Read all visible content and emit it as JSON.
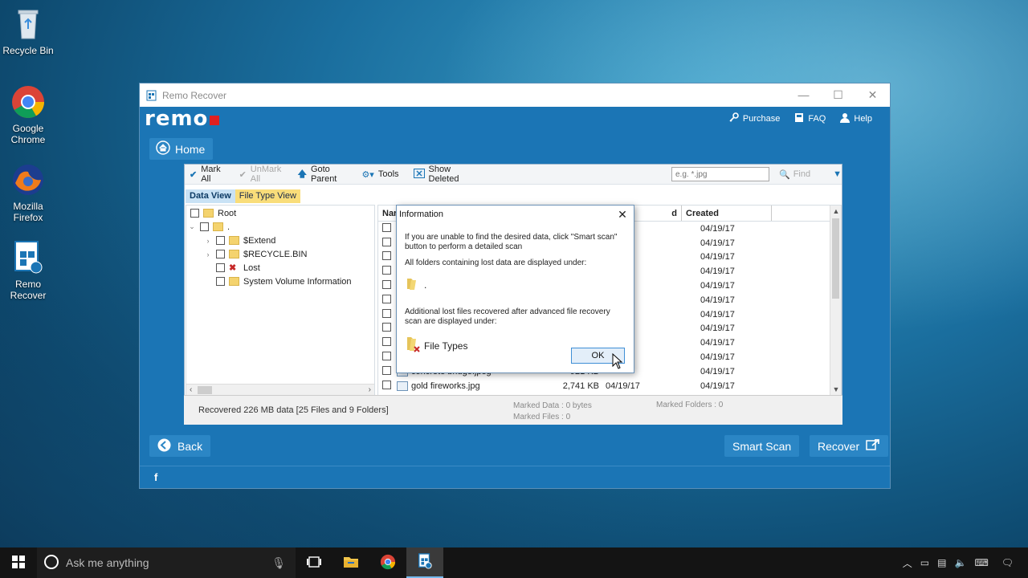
{
  "desktop": {
    "icons": [
      {
        "label": "Recycle Bin"
      },
      {
        "label": "Google Chrome"
      },
      {
        "label": "Mozilla Firefox"
      },
      {
        "label": "Remo Recover"
      }
    ]
  },
  "window": {
    "title": "Remo Recover",
    "brand": "remo",
    "links": {
      "purchase": "Purchase",
      "faq": "FAQ",
      "help": "Help"
    },
    "home_label": "Home"
  },
  "toolbar": {
    "mark_all": "Mark All",
    "unmark_all": "UnMark All",
    "goto_parent": "Goto Parent",
    "tools": "Tools",
    "show_deleted": "Show Deleted",
    "search_placeholder": "e.g. *.jpg",
    "find": "Find"
  },
  "tabs": {
    "data_view": "Data View",
    "file_type_view": "File Type View"
  },
  "tree": {
    "root": "Root",
    "child": ".",
    "items": [
      "$Extend",
      "$RECYCLE.BIN",
      "Lost",
      "System Volume Information"
    ]
  },
  "list": {
    "columns": {
      "name": "Nar",
      "modified": "d",
      "created": "Created"
    },
    "created_dates": [
      "04/19/17",
      "04/19/17",
      "04/19/17",
      "04/19/17",
      "04/19/17",
      "04/19/17",
      "04/19/17",
      "04/19/17",
      "04/19/17",
      "04/19/17",
      "04/19/17",
      "04/19/17"
    ],
    "partial_row": {
      "name": "concrete bridge.jpeg",
      "size": "921 KB"
    },
    "last_row": {
      "name": "gold fireworks.jpg",
      "size": "2,741 KB",
      "modified": "04/19/17",
      "created": "04/19/17"
    }
  },
  "status": {
    "recovered": "Recovered 226 MB data [25 Files and 9 Folders]",
    "marked_data": "Marked Data : 0 bytes",
    "marked_files": "Marked Files : 0",
    "marked_folders": "Marked Folders : 0"
  },
  "footer": {
    "back": "Back",
    "smart_scan": "Smart Scan",
    "recover": "Recover",
    "facebook": "f"
  },
  "dialog": {
    "title": "Information",
    "line1": "If you are unable to find the desired data, click \"Smart scan\" button to perform a detailed scan",
    "line2": "All folders containing lost data are displayed under:",
    "folder1": ".",
    "line3": "Additional lost files recovered after advanced file recovery scan are displayed under:",
    "folder2": "File Types",
    "ok": "OK"
  },
  "taskbar": {
    "search_placeholder": "Ask me anything"
  }
}
